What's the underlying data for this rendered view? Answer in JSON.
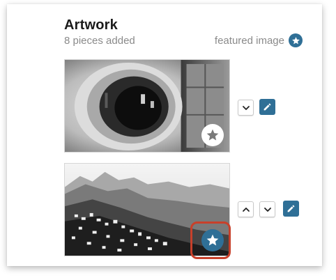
{
  "section": {
    "title": "Artwork",
    "count_text": "8 pieces added",
    "featured_label": "featured image",
    "featured_icon": "star-icon"
  },
  "artworks": [
    {
      "subject": "abstract architecture with circular opening",
      "featured": false,
      "controls": [
        "move-down",
        "edit"
      ]
    },
    {
      "subject": "coastal hillside town with mountains",
      "featured": true,
      "controls": [
        "move-up",
        "move-down",
        "edit"
      ]
    }
  ],
  "colors": {
    "accent": "#2f6f96",
    "highlight": "#c8402a",
    "muted_text": "#8a8a8a",
    "title_text": "#1b1b1b"
  }
}
